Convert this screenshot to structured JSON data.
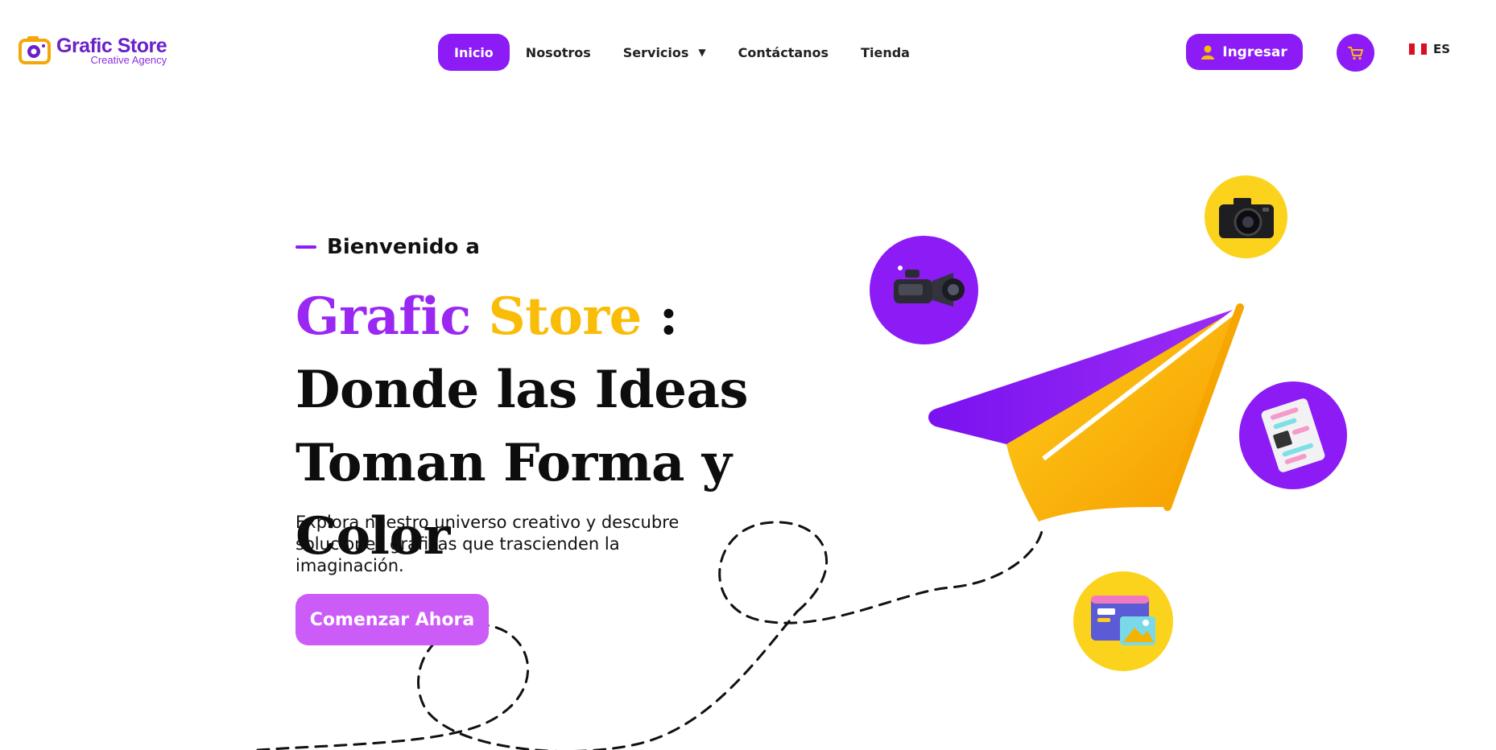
{
  "brand": {
    "name": "Grafic Store",
    "tagline": "Creative Agency"
  },
  "nav": {
    "items": [
      {
        "label": "Inicio",
        "active": true
      },
      {
        "label": "Nosotros"
      },
      {
        "label": "Servicios",
        "has_dropdown": true
      },
      {
        "label": "Contáctanos"
      },
      {
        "label": "Tienda"
      }
    ]
  },
  "header_actions": {
    "login_label": "Ingresar",
    "cart_icon": "cart-icon",
    "language": "ES"
  },
  "hero": {
    "eyebrow": "Bienvenido a",
    "headline": {
      "part1": "Grafic",
      "part2": "Store",
      "part3": " : Donde las Ideas Toman Forma y Color"
    },
    "subtitle": "Explora nuestro universo creativo y descubre soluciones gráficas que trascienden la imaginación.",
    "cta_label": "Comenzar Ahora"
  },
  "colors": {
    "primary": "#8c1bf5",
    "accent_yellow": "#f9bd08",
    "cta": "#cc5cf7"
  },
  "illustrations": [
    "video-camera-icon",
    "photo-camera-icon",
    "paper-plane-illustration",
    "document-icon",
    "web-design-icon"
  ]
}
